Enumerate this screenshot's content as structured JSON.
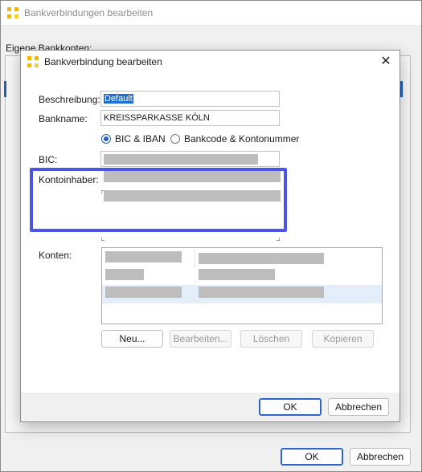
{
  "outer_window": {
    "title": "Bankverbindungen bearbeiten",
    "section_label": "Eigene Bankkonten:",
    "ok_label": "OK",
    "cancel_label": "Abbrechen"
  },
  "dialog": {
    "title": "Bankverbindung bearbeiten",
    "close_label": "✕",
    "beschreibung_label": "Beschreibung:",
    "beschreibung_value": "Default",
    "bankname_label": "Bankname:",
    "bankname_value": "KREISSPARKASSE KÖLN",
    "radio_bic_iban": "BIC & IBAN",
    "radio_bankcode": "Bankcode & Kontonummer",
    "bic_label": "BIC:",
    "kontoinhaber_label": "Kontoinhaber:",
    "konten_label": "Konten:",
    "buttons": {
      "neu": "Neu...",
      "bearbeiten": "Bearbeiten...",
      "loeschen": "Löschen",
      "kopieren": "Kopieren"
    },
    "ok_label": "OK",
    "cancel_label": "Abbrechen"
  },
  "colors": {
    "highlight_border": "#4d55e8",
    "accent": "#2f64c8",
    "app_icon": "#f2b800"
  }
}
